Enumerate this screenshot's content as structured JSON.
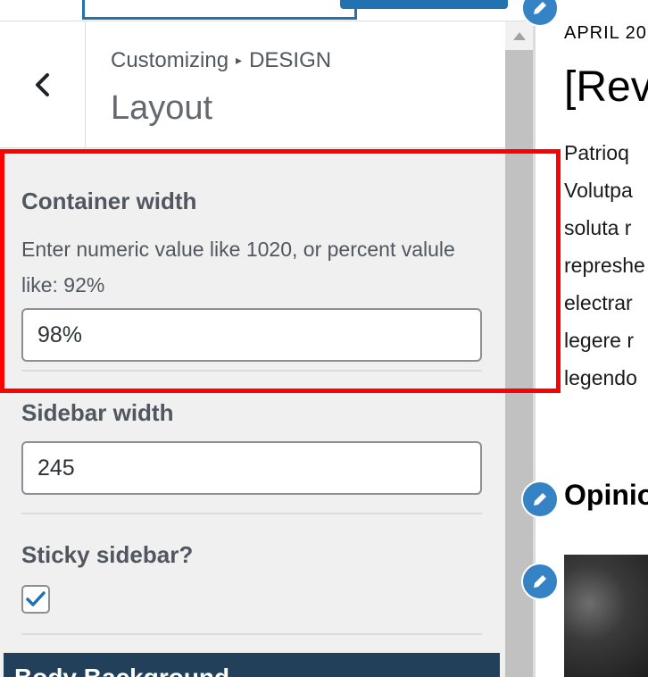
{
  "header": {
    "back_label": "Back",
    "breadcrumb": {
      "root": "Customizing",
      "separator": "▸",
      "section": "DESIGN"
    },
    "title": "Layout"
  },
  "controls": {
    "container_width": {
      "title": "Container width",
      "description": "Enter numeric value like 1020, or percent valule like: 92%",
      "value": "98%"
    },
    "sidebar_width": {
      "title": "Sidebar width",
      "value": "245"
    },
    "sticky_sidebar": {
      "title": "Sticky sidebar?",
      "checked": true
    },
    "next_section": {
      "title": "Body Background"
    }
  },
  "preview": {
    "date": "APRIL 20",
    "title": "[Rev",
    "body_lines": [
      "Patrioq",
      "Volutpa",
      "soluta r",
      "represhe",
      "electrar",
      "legere r",
      "legendo"
    ],
    "heading": "Opinio"
  },
  "colors": {
    "accent": "#2271b1",
    "highlight": "#ff0000",
    "section_bar": "#23405b",
    "edit_pen": "#3582c4"
  },
  "icons": {
    "back": "chevron-left-icon",
    "scroll_up": "triangle-up-icon",
    "check": "checkmark-icon",
    "edit": "pencil-icon"
  }
}
